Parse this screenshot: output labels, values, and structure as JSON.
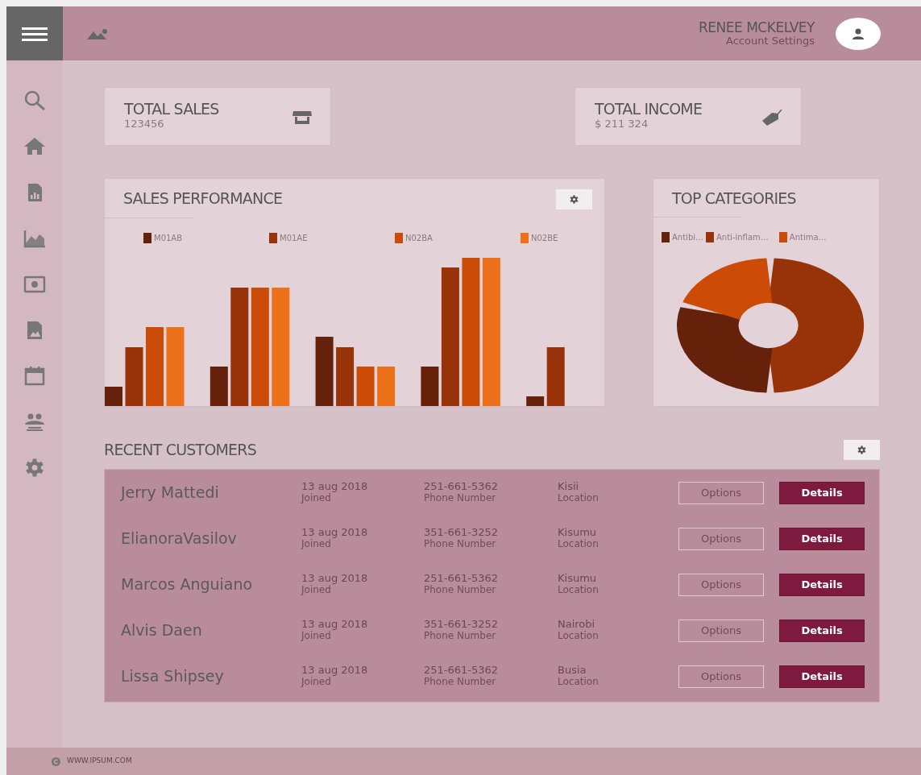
{
  "header": {
    "user_name": "RENEE MCKELVEY",
    "account_link": "Account Settings"
  },
  "stats": [
    {
      "title": "TOTAL SALES",
      "value": "123456"
    },
    {
      "title": "TOTAL INCOME",
      "value": "$ 211 324"
    }
  ],
  "sales_performance": {
    "title": "SALES PERFORMANCE",
    "legend": [
      {
        "label": "M01AB",
        "color": "#65210a"
      },
      {
        "label": "M01AE",
        "color": "#983209"
      },
      {
        "label": "N02BA",
        "color": "#cc4b06"
      },
      {
        "label": "N02BE",
        "color": "#ec7118"
      }
    ]
  },
  "top_categories": {
    "title": "TOP CATEGORIES",
    "legend": [
      {
        "label": "Antibi…",
        "color": "#65210a"
      },
      {
        "label": "Anti-inflam…",
        "color": "#983209"
      },
      {
        "label": "Antima…",
        "color": "#cc4b06"
      }
    ]
  },
  "recent_customers": {
    "title": "RECENT CUSTOMERS",
    "rows": [
      {
        "name": "Jerry Mattedi",
        "joined": "13 aug 2018",
        "joined_label": "Joined",
        "phone": "251-661-5362",
        "phone_label": "Phone Number",
        "location": "Kisii",
        "location_label": "Location",
        "options": "Options",
        "details": "Details"
      },
      {
        "name": "ElianoraVasilov",
        "joined": "13 aug 2018",
        "joined_label": "Joined",
        "phone": "351-661-3252",
        "phone_label": "Phone Number",
        "location": "Kisumu",
        "location_label": "Location",
        "options": "Options",
        "details": "Details"
      },
      {
        "name": "Marcos Anguiano",
        "joined": "13 aug 2018",
        "joined_label": "Joined",
        "phone": "251-661-5362",
        "phone_label": "Phone Number",
        "location": "Kisumu",
        "location_label": "Location",
        "options": "Options",
        "details": "Details"
      },
      {
        "name": "Alvis Daen",
        "joined": "13 aug 2018",
        "joined_label": "Joined",
        "phone": "351-661-3252",
        "phone_label": "Phone Number",
        "location": "Nairobi",
        "location_label": "Location",
        "options": "Options",
        "details": "Details"
      },
      {
        "name": "Lissa Shipsey",
        "joined": "13 aug 2018",
        "joined_label": "Joined",
        "phone": "251-661-5362",
        "phone_label": "Phone Number",
        "location": "Busia",
        "location_label": "Location",
        "options": "Options",
        "details": "Details"
      }
    ]
  },
  "footer": {
    "text": "WWW.IPSUM.COM"
  }
}
